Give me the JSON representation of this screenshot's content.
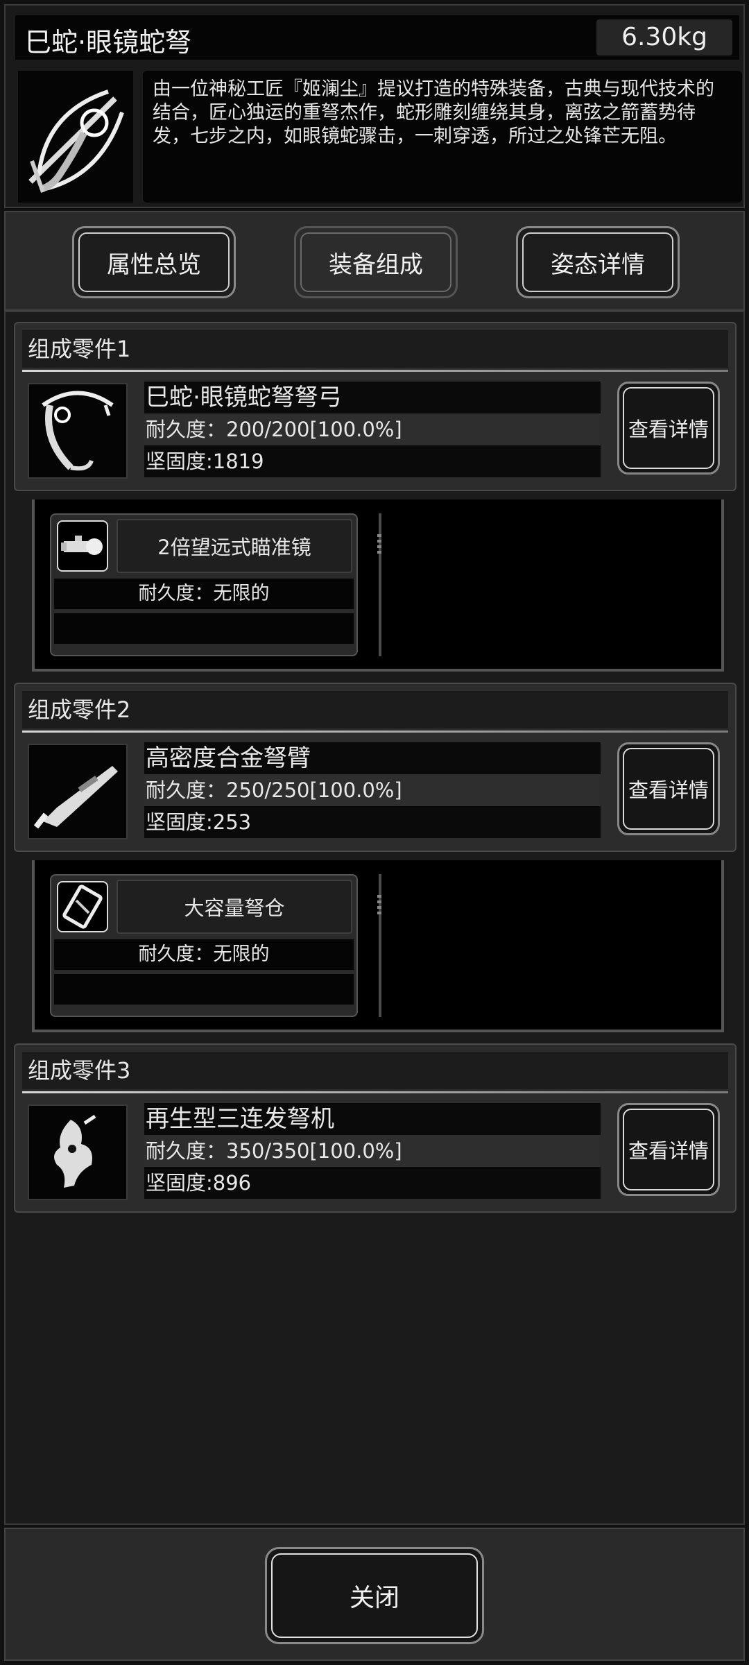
{
  "header": {
    "title": "巳蛇·眼镜蛇弩",
    "weight": "6.30kg",
    "description": "由一位神秘工匠『姬澜尘』提议打造的特殊装备，古典与现代技术的结合，匠心独运的重弩杰作，蛇形雕刻缠绕其身，离弦之箭蓄势待发，七步之内，如眼镜蛇骤击，一刺穿透，所过之处锋芒无阻。"
  },
  "tabs": [
    {
      "label": "属性总览"
    },
    {
      "label": "装备组成"
    },
    {
      "label": "姿态详情"
    }
  ],
  "parts": [
    {
      "header": "组成零件1",
      "name": "巳蛇·眼镜蛇弩弩弓",
      "durability": "耐久度：200/200[100.0%]",
      "hardness": "坚固度:1819",
      "detail_label": "查看详情",
      "attachment": {
        "name": "2倍望远式瞄准镜",
        "durability": "耐久度：无限的"
      }
    },
    {
      "header": "组成零件2",
      "name": "高密度合金弩臂",
      "durability": "耐久度：250/250[100.0%]",
      "hardness": "坚固度:253",
      "detail_label": "查看详情",
      "attachment": {
        "name": "大容量弩仓",
        "durability": "耐久度：无限的"
      }
    },
    {
      "header": "组成零件3",
      "name": "再生型三连发弩机",
      "durability": "耐久度：350/350[100.0%]",
      "hardness": "坚固度:896",
      "detail_label": "查看详情"
    }
  ],
  "footer": {
    "close_label": "关闭"
  }
}
